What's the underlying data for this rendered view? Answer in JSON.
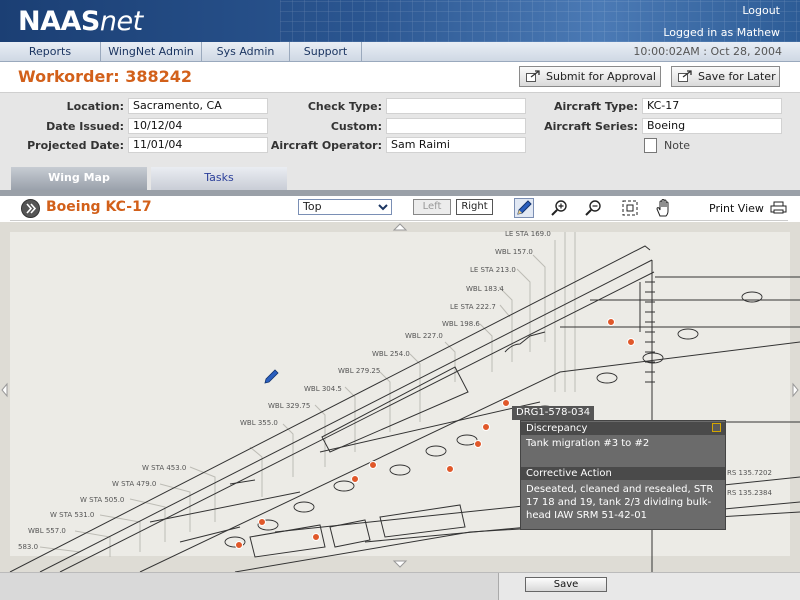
{
  "app": {
    "logo_main": "NAAS",
    "logo_suffix": "net",
    "logout": "Logout",
    "logged_in": "Logged in as Mathew"
  },
  "nav": {
    "items": [
      "Reports",
      "WingNet Admin",
      "Sys Admin",
      "Support"
    ],
    "datetime": "10:00:02AM : Oct 28, 2004"
  },
  "workorder": {
    "title": "Workorder: 388242",
    "submit_label": "Submit for Approval",
    "save_later_label": "Save for Later"
  },
  "info": {
    "location_label": "Location:",
    "location": "Sacramento, CA",
    "date_issued_label": "Date Issued:",
    "date_issued": "10/12/04",
    "projected_label": "Projected Date:",
    "projected": "11/01/04",
    "check_type_label": "Check Type:",
    "check_type": "",
    "custom_label": "Custom:",
    "custom": "",
    "operator_label": "Aircraft Operator:",
    "operator": "Sam Raimi",
    "aircraft_type_label": "Aircraft Type:",
    "aircraft_type": "KC-17",
    "aircraft_series_label": "Aircraft Series:",
    "aircraft_series": "Boeing",
    "note_label": "Note"
  },
  "tabs": {
    "wing_map": "Wing Map",
    "tasks": "Tasks"
  },
  "toolbar": {
    "aircraft": "Boeing KC-17",
    "view": "Top",
    "left": "Left",
    "right": "Right",
    "print_view": "Print View"
  },
  "map": {
    "labels": {
      "le169": "LE STA 169.0",
      "wbl157": "WBL 157.0",
      "le213": "LE STA 213.0",
      "wbl183": "WBL 183.4",
      "le222": "LE STA 222.7",
      "wbl198": "WBL 198.6",
      "wbl227": "WBL 227.0",
      "wbl254": "WBL 254.0",
      "wbl279": "WBL 279.25",
      "wbl304": "WBL 304.5",
      "wbl329": "WBL 329.75",
      "wbl355": "WBL 355.0",
      "wsta453": "W STA 453.0",
      "wsta479": "W STA 479.0",
      "wsta505": "W STA 505.0",
      "wsta531": "W STA 531.0",
      "wbl557": "WBL 557.0",
      "s583": "583.0",
      "rs7202": "RS 135.7202",
      "rs2384": "RS 135.2384"
    }
  },
  "popup": {
    "drg": "DRG1-578-034",
    "discrepancy_label": "Discrepancy",
    "discrepancy_text": "Tank migration #3 to #2",
    "corrective_label": "Corrective Action",
    "corrective_lines": [
      "Deseated, cleaned and resealed, STR",
      "17 18 and 19, tank 2/3 dividing bulk-",
      "head IAW SRM 51-42-01"
    ]
  },
  "bottom": {
    "save": "Save"
  },
  "colors": {
    "accent": "#d2601a",
    "header": "#1b3f74",
    "marker": "#e0582a"
  }
}
